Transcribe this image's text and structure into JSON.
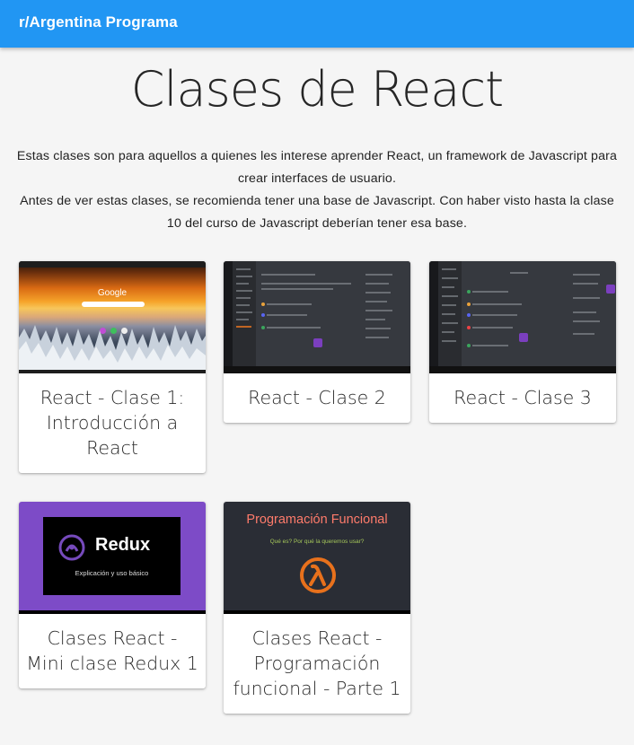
{
  "header": {
    "brand": "r/Argentina Programa"
  },
  "page": {
    "title": "Clases de React",
    "intro_1": "Estas clases son para aquellos a quienes les interese aprender React, un framework de Javascript para crear interfaces de usuario.",
    "intro_2": "Antes de ver estas clases, se recomienda tener una base de Javascript. Con haber visto hasta la clase 10 del curso de Javascript deberían tener esa base."
  },
  "cards": [
    {
      "title": "React - Clase 1: Introducción a React",
      "thumb_text": "Google"
    },
    {
      "title": "React - Clase 2"
    },
    {
      "title": "React - Clase 3"
    },
    {
      "title": "Clases React - Mini clase Redux 1",
      "thumb_text": "Redux",
      "thumb_subtext": "Explicación y uso básico"
    },
    {
      "title": "Clases React - Programación funcional - Parte 1",
      "thumb_text": "Programación Funcional",
      "thumb_subtext": "Qué es? Por qué la queremos usar?"
    }
  ],
  "colors": {
    "topbar": "#2196f3",
    "background": "#f5f5f5",
    "redux_bg": "#7d4bc7",
    "fp_title": "#ff7b6b",
    "lambda": "#e8711c"
  },
  "icons": {
    "redux": "redux-logo-icon",
    "lambda": "lambda-icon"
  }
}
